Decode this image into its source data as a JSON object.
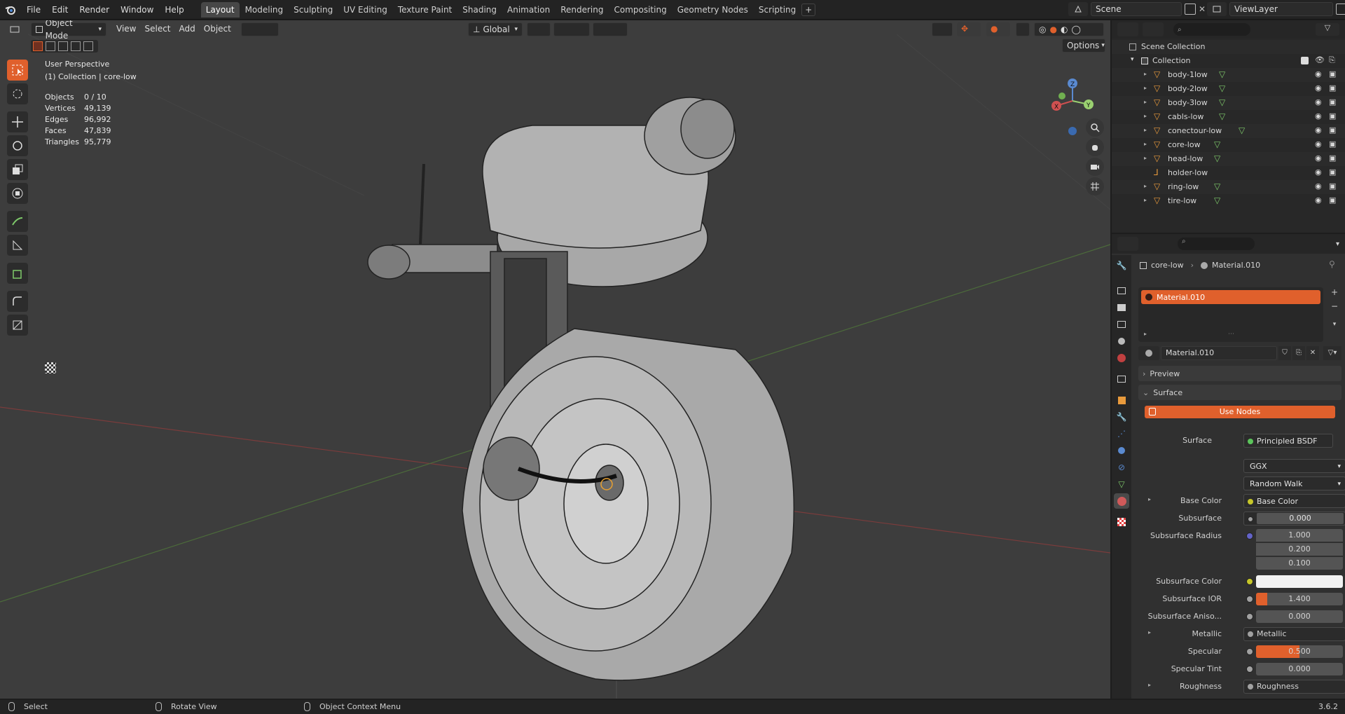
{
  "topbar": {
    "menus": [
      "File",
      "Edit",
      "Render",
      "Window",
      "Help"
    ],
    "workspaces": [
      "Layout",
      "Modeling",
      "Sculpting",
      "UV Editing",
      "Texture Paint",
      "Shading",
      "Animation",
      "Rendering",
      "Compositing",
      "Geometry Nodes",
      "Scripting"
    ],
    "active_workspace": "Layout",
    "add_tab": "+",
    "scene_name": "Scene",
    "view_layer": "ViewLayer"
  },
  "viewport": {
    "mode": "Object Mode",
    "menus": [
      "View",
      "Select",
      "Add",
      "Object"
    ],
    "transform_orientation": "Global",
    "options_label": "Options",
    "view_name": "User Perspective",
    "collection_info": "(1) Collection | core-low",
    "stats": [
      {
        "label": "Objects",
        "value": "0 / 10"
      },
      {
        "label": "Vertices",
        "value": "49,139"
      },
      {
        "label": "Edges",
        "value": "96,992"
      },
      {
        "label": "Faces",
        "value": "47,839"
      },
      {
        "label": "Triangles",
        "value": "95,779"
      }
    ],
    "gizmo_axes": {
      "x": "X",
      "y": "Y",
      "z": "Z"
    }
  },
  "outliner": {
    "root": "Scene Collection",
    "collection": "Collection",
    "items": [
      {
        "name": "body-1low",
        "type": "mesh"
      },
      {
        "name": "body-2low",
        "type": "mesh"
      },
      {
        "name": "body-3low",
        "type": "mesh"
      },
      {
        "name": "cabls-low",
        "type": "mesh"
      },
      {
        "name": "conectour-low",
        "type": "mesh"
      },
      {
        "name": "core-low",
        "type": "mesh"
      },
      {
        "name": "head-low",
        "type": "mesh"
      },
      {
        "name": "holder-low",
        "type": "empty"
      },
      {
        "name": "ring-low",
        "type": "mesh"
      },
      {
        "name": "tire-low",
        "type": "mesh"
      }
    ]
  },
  "properties": {
    "breadcrumb_object": "core-low",
    "breadcrumb_material": "Material.010",
    "slot_name": "Material.010",
    "material_name": "Material.010",
    "preview_label": "Preview",
    "surface_label": "Surface",
    "use_nodes_label": "Use Nodes",
    "surface_shader_label": "Surface",
    "surface_shader": "Principled BSDF",
    "distribution": "GGX",
    "subsurface_method": "Random Walk",
    "rows": {
      "base_color": {
        "label": "Base Color",
        "value": "Base Color"
      },
      "subsurface": {
        "label": "Subsurface",
        "value": "0.000"
      },
      "subsurface_radius": {
        "label": "Subsurface Radius",
        "values": [
          "1.000",
          "0.200",
          "0.100"
        ]
      },
      "subsurface_color": {
        "label": "Subsurface Color"
      },
      "subsurface_ior": {
        "label": "Subsurface IOR",
        "value": "1.400"
      },
      "subsurface_aniso": {
        "label": "Subsurface Aniso...",
        "value": "0.000"
      },
      "metallic": {
        "label": "Metallic",
        "value": "Metallic"
      },
      "specular": {
        "label": "Specular",
        "value": "0.500",
        "fill": 0.5
      },
      "specular_tint": {
        "label": "Specular Tint",
        "value": "0.000"
      },
      "roughness": {
        "label": "Roughness",
        "value": "Roughness"
      }
    }
  },
  "statusbar": {
    "select": "Select",
    "rotate": "Rotate View",
    "context": "Object Context Menu",
    "version": "3.6.2"
  },
  "colors": {
    "accent": "#e0602c",
    "viewport_bg": "#3d3d3d",
    "panel_bg": "#303030",
    "mesh_icon": "#e89a3c",
    "data_icon": "#7ec96a"
  }
}
